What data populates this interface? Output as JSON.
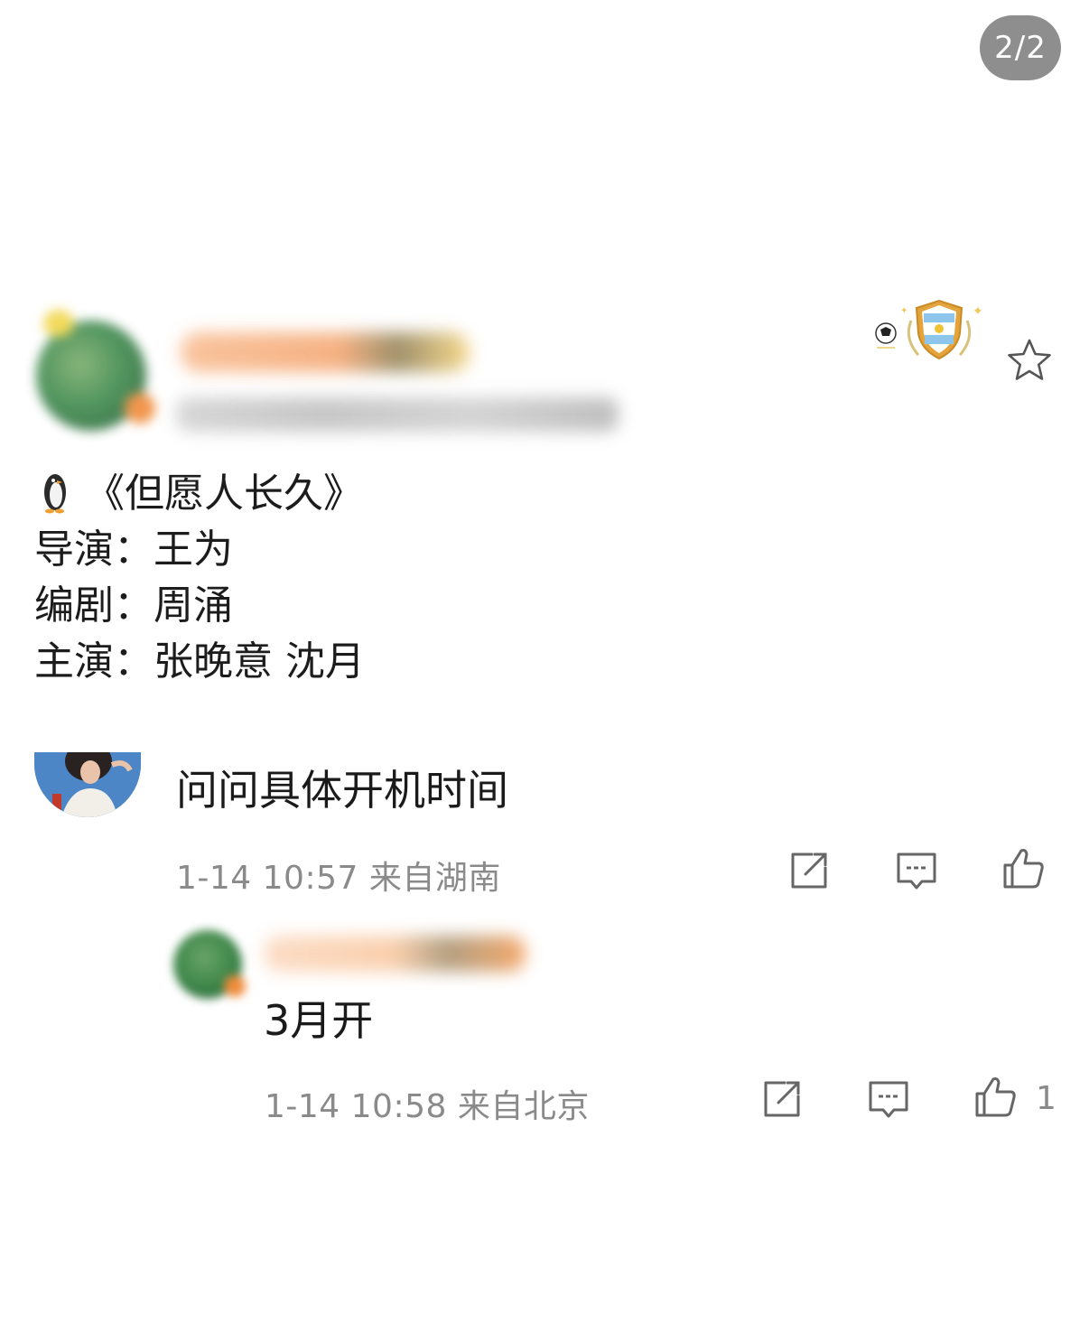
{
  "page_indicator": "2/2",
  "post": {
    "lines": [
      "《但愿人长久》",
      "导演：王为",
      "编剧：周涌",
      "主演：张晚意 沈月"
    ]
  },
  "comment": {
    "text": "问问具体开机时间",
    "meta": "1-14 10:57  来自湖南"
  },
  "reply": {
    "text": "3月开",
    "meta": "1-14 10:58  来自北京",
    "like_count": "1"
  },
  "icons": {
    "star": "star-icon",
    "share": "share-icon",
    "comment": "comment-icon",
    "like": "like-icon",
    "penguin": "penguin-icon",
    "badge": "argentina-shield-badge-icon"
  },
  "colors": {
    "meta_text": "#8a8a8a",
    "main_text": "#1c1c1c",
    "indicator_bg": "#8e8e8e"
  }
}
